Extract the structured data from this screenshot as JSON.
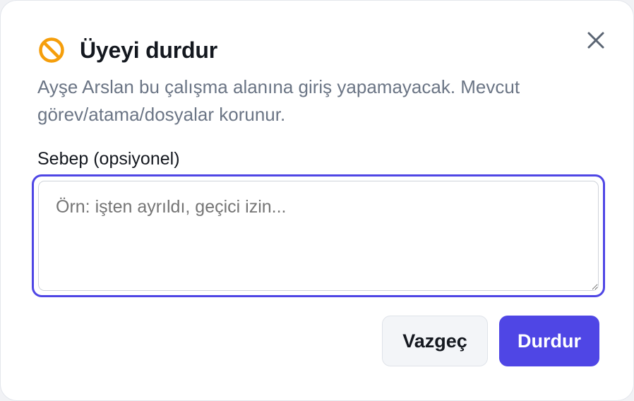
{
  "dialog": {
    "title": "Üyeyi durdur",
    "title_icon": "ban-icon",
    "close_icon": "close-icon",
    "description": "Ayşe Arslan bu çalışma alanına giriş yapamayacak. Mevcut görev/atama/dosyalar korunur.",
    "reason_label": "Sebep (opsiyonel)",
    "reason_value": "",
    "reason_placeholder": "Örn: işten ayrıldı, geçici izin...",
    "cancel_label": "Vazgeç",
    "confirm_label": "Durdur"
  },
  "colors": {
    "accent": "#4f46e5",
    "warning_icon": "#f59e0b",
    "title_text": "#14181f",
    "muted_text": "#6b7585"
  }
}
